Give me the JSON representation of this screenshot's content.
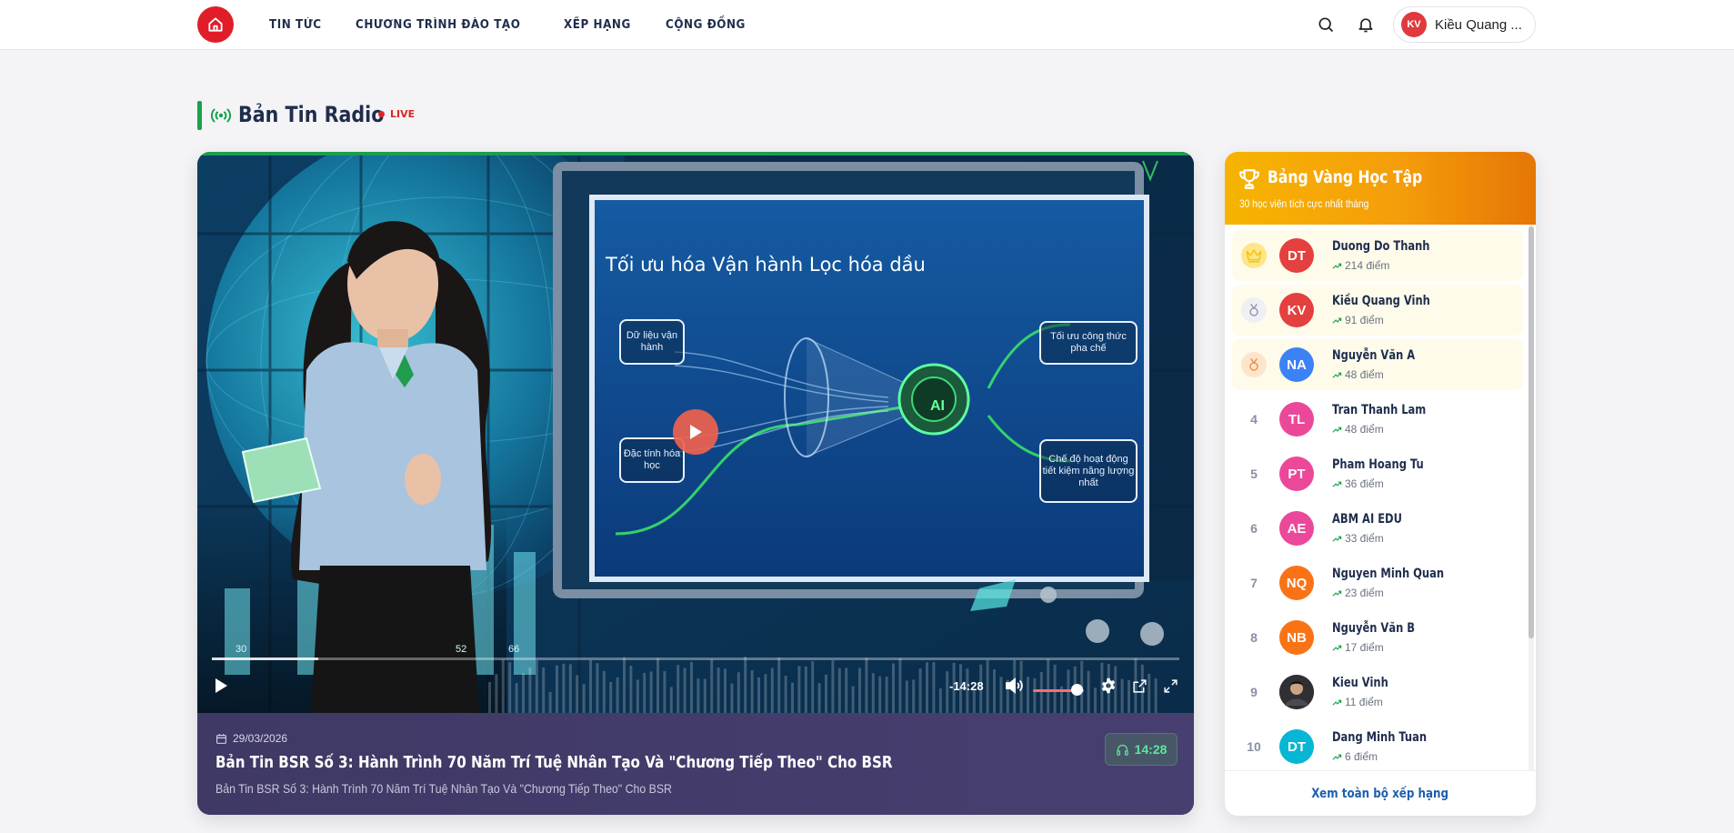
{
  "nav": {
    "items": [
      "TIN TỨC",
      "CHƯƠNG TRÌNH ĐÀO TẠO",
      "XẾP HẠNG",
      "CỘNG ĐỒNG"
    ]
  },
  "user": {
    "initials": "KV",
    "name": "Kiều Quang ..."
  },
  "section": {
    "title": "Bản Tin Radio",
    "live_label": "LIVE"
  },
  "slide": {
    "title": "Tối ưu hóa Vận hành Lọc hóa dầu",
    "input_1": "Dữ liệu vận hành",
    "input_2": "Đặc tính hóa học",
    "output_1": "Tối ưu công thức pha chế",
    "output_2": "Chế độ hoạt động tiết kiệm năng lượng nhất",
    "chip": "AI",
    "ticks": [
      "30",
      "52",
      "66"
    ]
  },
  "player": {
    "time_left": "-14:28",
    "progress": 0.11,
    "volume": 0.85
  },
  "episode": {
    "date": "29/03/2026",
    "title": "Bản Tin BSR Số 3: Hành Trình 70 Năm Trí Tuệ Nhân Tạo Và \"Chương Tiếp Theo\" Cho BSR",
    "subtitle": "Bản Tin BSR Số 3: Hành Trình 70 Năm Trí Tuệ Nhân Tạo Và \"Chương Tiếp Theo\" Cho BSR",
    "duration": "14:28"
  },
  "leaderboard": {
    "title": "Bảng Vàng Học Tập",
    "subtitle": "30 học viên tích cực nhất tháng",
    "footer_link": "Xem toàn bộ xếp hạng",
    "rows": [
      {
        "rank": "1",
        "initials": "DT",
        "name": "Duong Do Thanh",
        "points": "214 điểm",
        "color": "#e3403f"
      },
      {
        "rank": "2",
        "initials": "KV",
        "name": "Kiều Quang Vinh",
        "points": "91 điểm",
        "color": "#e3403f"
      },
      {
        "rank": "3",
        "initials": "NA",
        "name": "Nguyễn Văn A",
        "points": "48 điểm",
        "color": "#3b82f6"
      },
      {
        "rank": "4",
        "initials": "TL",
        "name": "Tran Thanh Lam",
        "points": "48 điểm",
        "color": "#ec4899"
      },
      {
        "rank": "5",
        "initials": "PT",
        "name": "Pham Hoang Tu",
        "points": "36 điểm",
        "color": "#ec4899"
      },
      {
        "rank": "6",
        "initials": "AE",
        "name": "ABM AI EDU",
        "points": "33 điểm",
        "color": "#ec4899"
      },
      {
        "rank": "7",
        "initials": "NQ",
        "name": "Nguyen Minh Quan",
        "points": "23 điểm",
        "color": "#f97316"
      },
      {
        "rank": "8",
        "initials": "NB",
        "name": "Nguyễn Văn B",
        "points": "17 điểm",
        "color": "#f97316"
      },
      {
        "rank": "9",
        "initials": "",
        "name": "Kieu Vinh",
        "points": "11 điểm",
        "color": "#3a3a3a"
      },
      {
        "rank": "10",
        "initials": "DT",
        "name": "Dang Minh Tuan",
        "points": "6 điểm",
        "color": "#06b6d4"
      }
    ]
  },
  "colors": {
    "brand_red": "#e11d2a",
    "accent_green": "#16a34a",
    "gold": "#f59e0b"
  }
}
